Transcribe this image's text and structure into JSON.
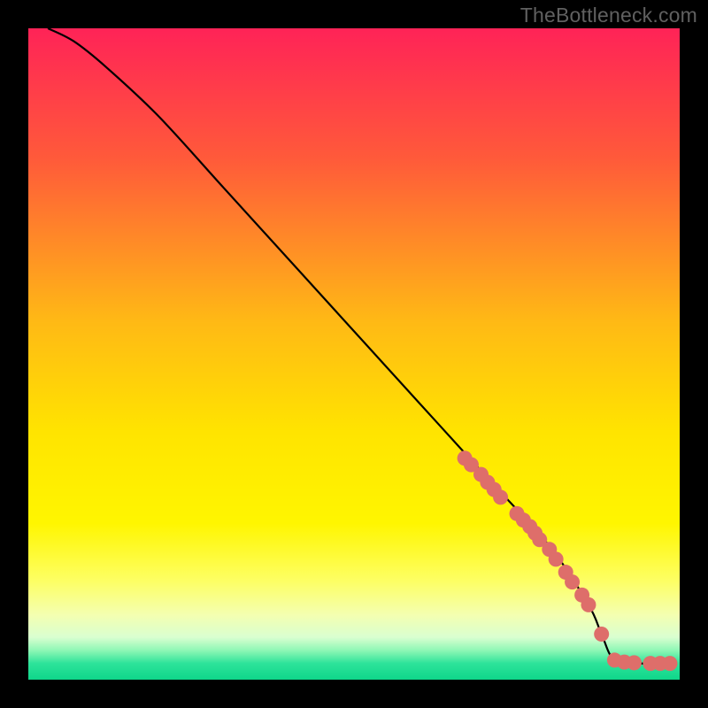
{
  "watermark": "TheBottleneck.com",
  "colors": {
    "background": "#000000",
    "watermark": "#606060",
    "curve": "#000000",
    "marker_fill": "#de6e6a",
    "marker_stroke": "#b44e4a",
    "gradient_stops": [
      {
        "offset": 0.0,
        "color": "#ff2357"
      },
      {
        "offset": 0.2,
        "color": "#ff5a3a"
      },
      {
        "offset": 0.45,
        "color": "#ffb915"
      },
      {
        "offset": 0.62,
        "color": "#ffe400"
      },
      {
        "offset": 0.76,
        "color": "#fff600"
      },
      {
        "offset": 0.85,
        "color": "#fdff66"
      },
      {
        "offset": 0.9,
        "color": "#f4ffb0"
      },
      {
        "offset": 0.935,
        "color": "#d9ffd0"
      },
      {
        "offset": 0.955,
        "color": "#8ef7b5"
      },
      {
        "offset": 0.975,
        "color": "#2de39a"
      },
      {
        "offset": 1.0,
        "color": "#0fd68a"
      }
    ]
  },
  "chart_data": {
    "type": "line",
    "title": "",
    "xlabel": "",
    "ylabel": "",
    "xlim": [
      0,
      100
    ],
    "ylim": [
      0,
      100
    ],
    "grid": false,
    "legend": false,
    "series": [
      {
        "name": "bottleneck-curve",
        "x": [
          3,
          7,
          12,
          20,
          30,
          40,
          50,
          60,
          70,
          80,
          86,
          88,
          90,
          94,
          98
        ],
        "y": [
          100,
          98,
          94,
          86.5,
          75.5,
          64.5,
          53.5,
          42.5,
          31.5,
          20.5,
          11.5,
          7,
          3,
          2.5,
          2.5
        ]
      }
    ],
    "markers": {
      "name": "highlighted-points",
      "x": [
        67,
        68,
        69.5,
        70.5,
        71.5,
        72.5,
        75,
        76,
        77,
        77.8,
        78.5,
        80,
        81,
        82.5,
        83.5,
        85,
        86,
        88,
        90,
        91.5,
        93,
        95.5,
        97,
        98.5
      ],
      "y": [
        34,
        33,
        31.5,
        30.3,
        29.2,
        28,
        25.5,
        24.5,
        23.5,
        22.5,
        21.5,
        20,
        18.5,
        16.5,
        15,
        13,
        11.5,
        7,
        3,
        2.7,
        2.6,
        2.5,
        2.5,
        2.5
      ]
    }
  }
}
